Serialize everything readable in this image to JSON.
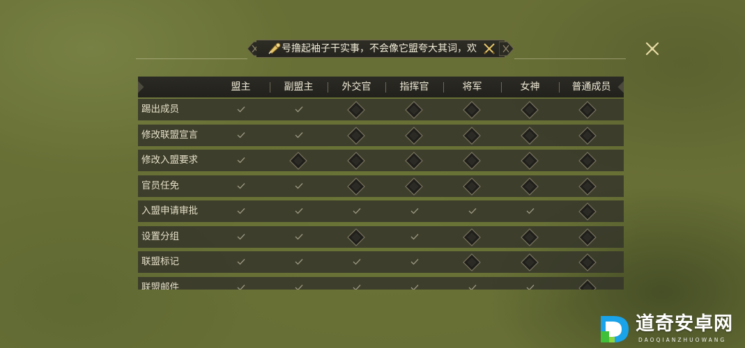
{
  "banner": {
    "text": "号撸起袖子干实事，不会像它盟夸大其词，欢",
    "left_icon": "horn-icon",
    "right_icon": "crossed-swords-icon"
  },
  "close_icon": "close-icon",
  "table": {
    "headers": [
      "盟主",
      "副盟主",
      "外交官",
      "指挥官",
      "将军",
      "女神",
      "普通成员"
    ],
    "rows": [
      {
        "label": "踢出成员",
        "perms": [
          "check",
          "check",
          "lock",
          "lock",
          "lock",
          "lock",
          "lock"
        ]
      },
      {
        "label": "修改联盟宣言",
        "perms": [
          "check",
          "check",
          "lock",
          "lock",
          "lock",
          "lock",
          "lock"
        ]
      },
      {
        "label": "修改入盟要求",
        "perms": [
          "check",
          "lock",
          "lock",
          "lock",
          "lock",
          "lock",
          "lock"
        ]
      },
      {
        "label": "官员任免",
        "perms": [
          "check",
          "check",
          "lock",
          "lock",
          "lock",
          "lock",
          "lock"
        ]
      },
      {
        "label": "入盟申请审批",
        "perms": [
          "check",
          "check",
          "check",
          "check",
          "check",
          "check",
          "lock"
        ]
      },
      {
        "label": "设置分组",
        "perms": [
          "check",
          "check",
          "lock",
          "check",
          "lock",
          "lock",
          "lock"
        ]
      },
      {
        "label": "联盟标记",
        "perms": [
          "check",
          "check",
          "check",
          "check",
          "lock",
          "lock",
          "lock"
        ]
      },
      {
        "label": "联盟邮件",
        "perms": [
          "check",
          "check",
          "check",
          "check",
          "check",
          "check",
          "lock"
        ]
      }
    ]
  },
  "watermark": {
    "title": "道奇安卓网",
    "subtitle": "DAOQIANZHUOWANG"
  },
  "colors": {
    "check": "#9d9a86",
    "lock_fill": "#1f1e1a",
    "lock_border": "#7a7562",
    "row_bg": "#36352a",
    "logo_blue": "#1aa3e8",
    "logo_green": "#3fbf3a"
  }
}
